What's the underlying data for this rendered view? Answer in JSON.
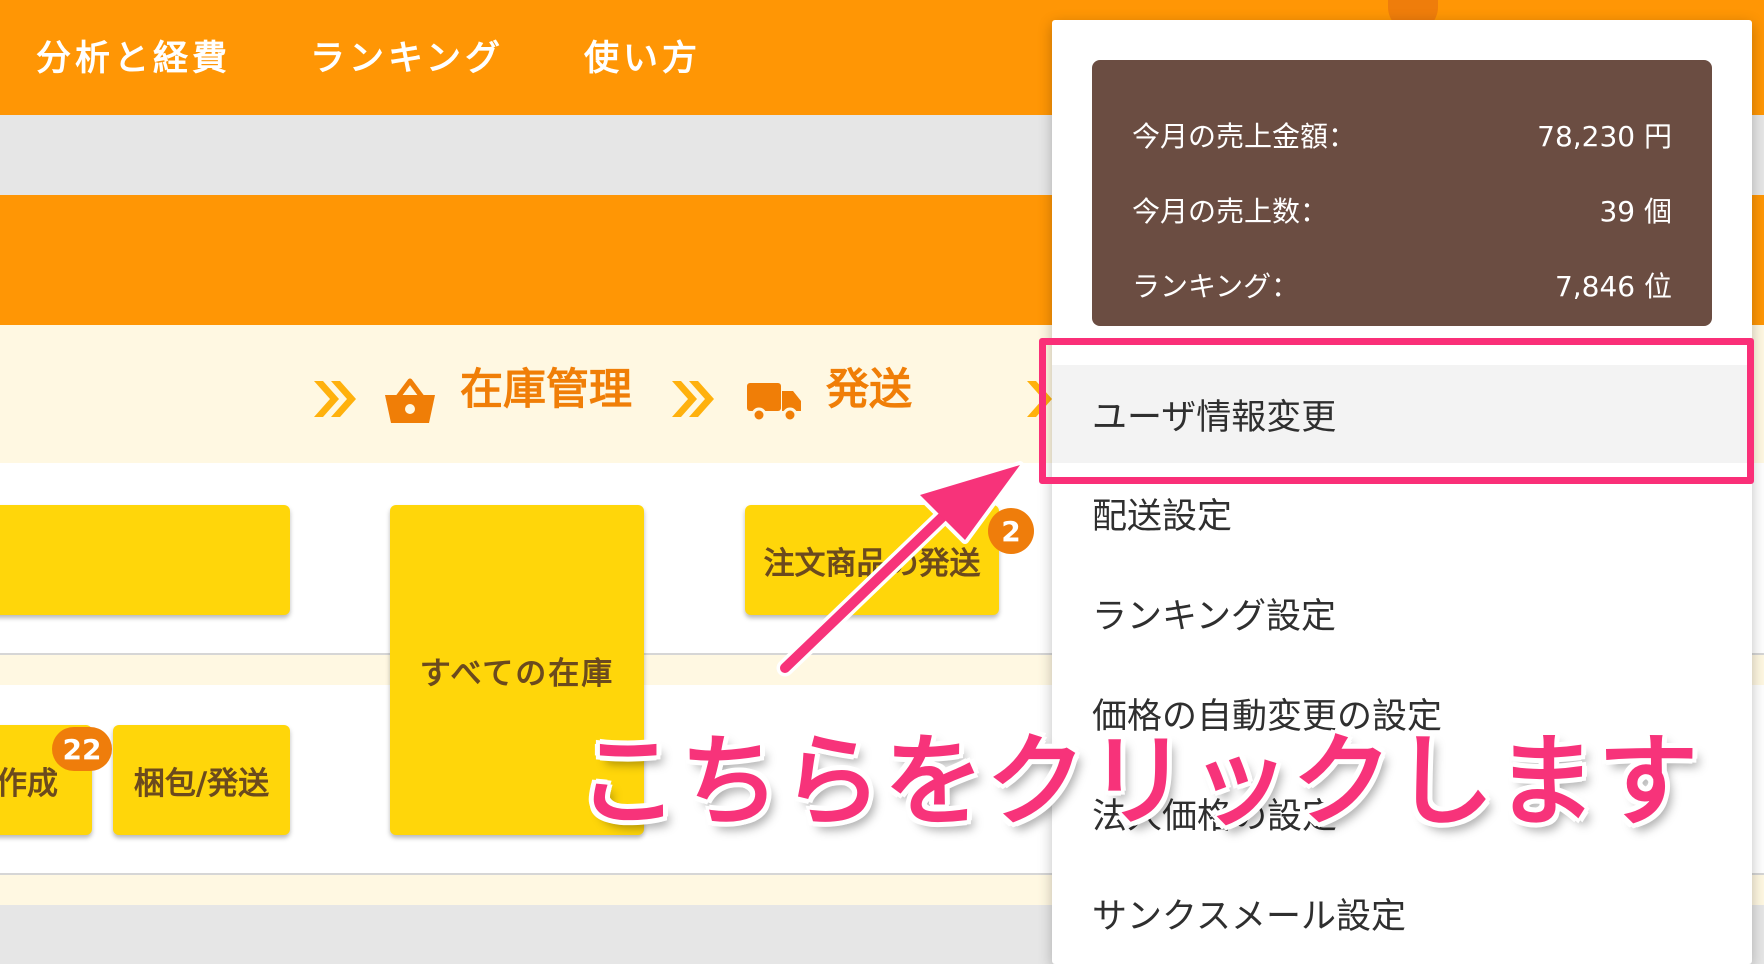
{
  "nav": {
    "items": [
      {
        "label": "分析と経費"
      },
      {
        "label": "ランキング"
      },
      {
        "label": "使い方"
      }
    ]
  },
  "steps": {
    "inventory": "在庫管理",
    "shipping": "発送"
  },
  "tiles": {
    "all_inventory": "すべての在庫",
    "order_ship": "注文商品の発送",
    "create": "作成",
    "pack_ship": "梱包/発送"
  },
  "badges": {
    "create_count": "22",
    "order_count": "2"
  },
  "summary": {
    "amount_label": "今月の売上金額：",
    "amount_value": "78,230 円",
    "count_label": "今月の売上数：",
    "count_value": "39 個",
    "rank_label": "ランキング：",
    "rank_value": "7,846 位"
  },
  "menu": {
    "items": [
      {
        "label": "ユーザ情報変更"
      },
      {
        "label": "配送設定"
      },
      {
        "label": "ランキング設定"
      },
      {
        "label": "価格の自動変更の設定"
      },
      {
        "label": "法人価格の設定"
      },
      {
        "label": "サンクスメール設定"
      }
    ]
  },
  "annotation": {
    "text": "こちらをクリックします"
  },
  "colors": {
    "header": "#ff9605",
    "tile": "#ffd60a",
    "summary_bg": "#6b4d42",
    "highlight": "#fa2f78",
    "step_text": "#f07e07"
  },
  "icons": [
    "double-chevron-icon",
    "basket-icon",
    "truck-icon"
  ]
}
